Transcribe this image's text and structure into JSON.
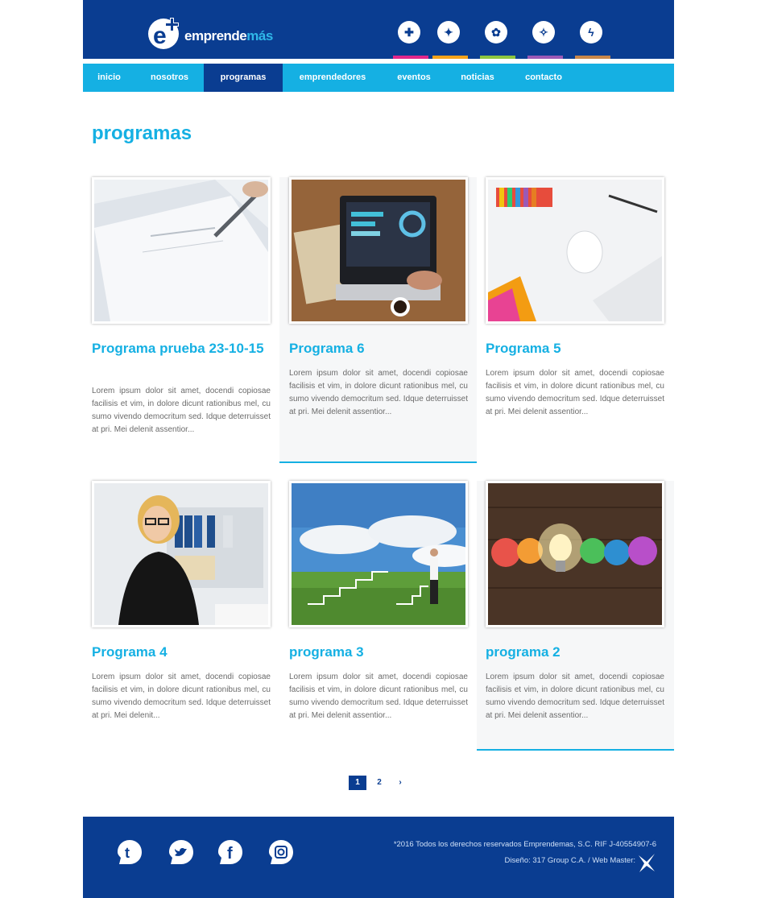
{
  "header": {
    "logo_text": "emprende",
    "logo_accent": "más",
    "logo_symbol": "e+",
    "icons": [
      {
        "name": "innovation-icon",
        "color": "#e2268a"
      },
      {
        "name": "ideas-icon",
        "color": "#f5a31a"
      },
      {
        "name": "growth-icon",
        "color": "#8cc63f"
      },
      {
        "name": "support-icon",
        "color": "#9b59b6"
      },
      {
        "name": "energy-icon",
        "color": "#c8874a"
      }
    ]
  },
  "nav": {
    "items": [
      "inicio",
      "nosotros",
      "programas",
      "emprendedores",
      "eventos",
      "noticias",
      "contacto"
    ],
    "active": "programas"
  },
  "page": {
    "title": "programas"
  },
  "cards": [
    {
      "title": "Programa prueba 23-10-15",
      "excerpt": "Lorem ipsum dolor sit amet, docendi copiosae facilisis et vim, in dolore dicunt rationibus mel, cu sumo vivendo democritum sed. Idque deterruisset at pri. Mei delenit assentior...",
      "image": "pen-document-photo"
    },
    {
      "title": "Programa 6",
      "excerpt": "Lorem ipsum dolor sit amet, docendi copiosae facilisis et vim, in dolore dicunt rationibus mel, cu sumo vivendo democritum sed. Idque deterruisset at pri. Mei delenit assentior...",
      "image": "laptop-desk-photo"
    },
    {
      "title": "Programa 5",
      "excerpt": "Lorem ipsum dolor sit amet, docendi copiosae facilisis et vim, in dolore dicunt rationibus mel, cu sumo vivendo democritum sed. Idque deterruisset at pri. Mei delenit assentior...",
      "image": "design-tools-photo"
    },
    {
      "title": "Programa 4",
      "excerpt": "Lorem ipsum dolor sit amet, docendi copiosae facilisis et vim, in dolore dicunt rationibus mel, cu sumo vivendo democritum sed. Idque deterruisset at pri. Mei delenit...",
      "image": "woman-office-photo"
    },
    {
      "title": "programa 3",
      "excerpt": "Lorem ipsum dolor sit amet, docendi copiosae facilisis et vim, in dolore dicunt rationibus mel, cu sumo vivendo democritum sed. Idque deterruisset at pri. Mei delenit assentior...",
      "image": "man-stairs-field-photo"
    },
    {
      "title": "programa 2",
      "excerpt": "Lorem ipsum dolor sit amet, docendi copiosae facilisis et vim, in dolore dicunt rationibus mel, cu sumo vivendo democritum sed. Idque deterruisset at pri. Mei delenit assentior...",
      "image": "lightbulb-paper-photo"
    }
  ],
  "pagination": {
    "current": "1",
    "next_page": "2",
    "next_arrow": "›"
  },
  "footer": {
    "social": [
      "tumblr-icon",
      "twitter-icon",
      "facebook-icon",
      "instagram-icon"
    ],
    "copyright": "*2016 Todos los derechos reservados Emprendemas, S.C. RIF J-40554907-6",
    "credits": "Diseño: 317 Group C.A. / Web Master:"
  },
  "colors": {
    "primary": "#0a3d91",
    "accent": "#15b0e3",
    "text": "#6b6b6b"
  }
}
